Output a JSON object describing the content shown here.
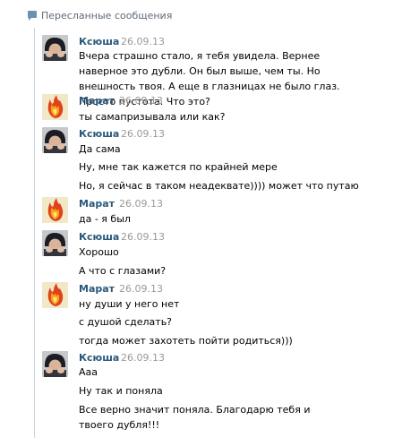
{
  "header": {
    "title": "Пересланные сообщения"
  },
  "messages": [
    {
      "author": "Ксюша",
      "date": "26.09.13",
      "avatar": "ksyusha",
      "lines": [
        "Вчера страшно стало, я тебя увидела. Вернее наверное это дубли. Он был выше, чем ты. Но внешность твоя. А еще в глазницах не было глаз. Просто пустота. Что это?"
      ]
    },
    {
      "author": "Марат",
      "date": "26.09.13",
      "avatar": "marat",
      "lines": [
        "ты самапризывала или как?"
      ]
    },
    {
      "author": "Ксюша",
      "date": "26.09.13",
      "avatar": "ksyusha",
      "lines": [
        "Да сама",
        "Ну, мне так кажется по крайней мере",
        "Но, я сейчас в таком неадеквате)))) может что путаю"
      ]
    },
    {
      "author": "Марат",
      "date": "26.09.13",
      "avatar": "marat",
      "lines": [
        "да - я был"
      ]
    },
    {
      "author": "Ксюша",
      "date": "26.09.13",
      "avatar": "ksyusha",
      "lines": [
        "Хорошо",
        "А что с глазами?"
      ]
    },
    {
      "author": "Марат",
      "date": "26.09.13",
      "avatar": "marat",
      "lines": [
        "ну души у него нет",
        "с душой сделать?",
        "тогда может захотеть пойти родиться)))"
      ]
    },
    {
      "author": "Ксюша",
      "date": "26.09.13",
      "avatar": "ksyusha",
      "lines": [
        "Ааа",
        "Ну так и поняла",
        "Все верно значит поняла. Благодарю тебя и твоего дубля!!!"
      ]
    }
  ]
}
